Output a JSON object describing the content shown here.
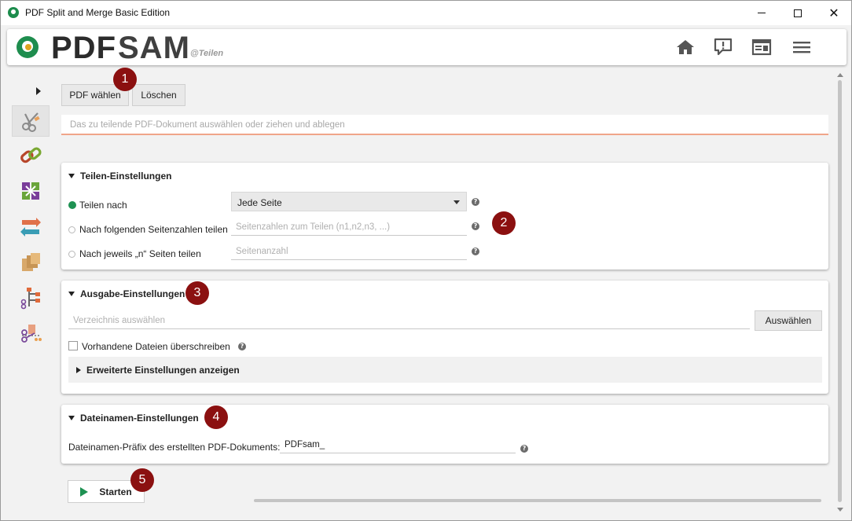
{
  "window": {
    "title": "PDF Split and Merge Basic Edition"
  },
  "header": {
    "logo_pdf": "PDF",
    "logo_sam": "SAM",
    "module_tag": "@Teilen",
    "icons": [
      "home-icon",
      "feedback-icon",
      "news-icon",
      "menu-icon"
    ]
  },
  "sidebar": {
    "items": [
      "split-icon",
      "merge-icon",
      "rotate-pages-icon",
      "alternate-mix-icon",
      "extract-pages-icon",
      "split-by-bookmarks-icon",
      "split-by-size-icon"
    ]
  },
  "toolbar": {
    "select_pdf": "PDF wählen",
    "clear": "Löschen",
    "drop_placeholder": "Das zu teilende PDF-Dokument auswählen oder ziehen und ablegen"
  },
  "split_settings": {
    "title": "Teilen-Einstellungen",
    "option1_label": "Teilen nach",
    "option1_value": "Jede Seite",
    "option2_label": "Nach folgenden Seitenzahlen teilen",
    "option2_placeholder": "Seitenzahlen zum Teilen (n1,n2,n3, ...)",
    "option3_label": "Nach jeweils „n“ Seiten teilen",
    "option3_placeholder": "Seitenanzahl"
  },
  "output_settings": {
    "title": "Ausgabe-Einstellungen",
    "dir_placeholder": "Verzeichnis auswählen",
    "browse": "Auswählen",
    "overwrite": "Vorhandene Dateien überschreiben",
    "advanced": "Erweiterte Einstellungen anzeigen"
  },
  "filename_settings": {
    "title": "Dateinamen-Einstellungen",
    "prefix_label": "Dateinamen-Präfix des erstellten PDF-Dokuments:",
    "prefix_value": "PDFsam_"
  },
  "actions": {
    "start": "Starten"
  },
  "markers": [
    "1",
    "2",
    "3",
    "4",
    "5"
  ],
  "colors": {
    "accent_green": "#1e9152",
    "marker_red": "#8b1010",
    "drop_underline": "#f0a58a"
  }
}
